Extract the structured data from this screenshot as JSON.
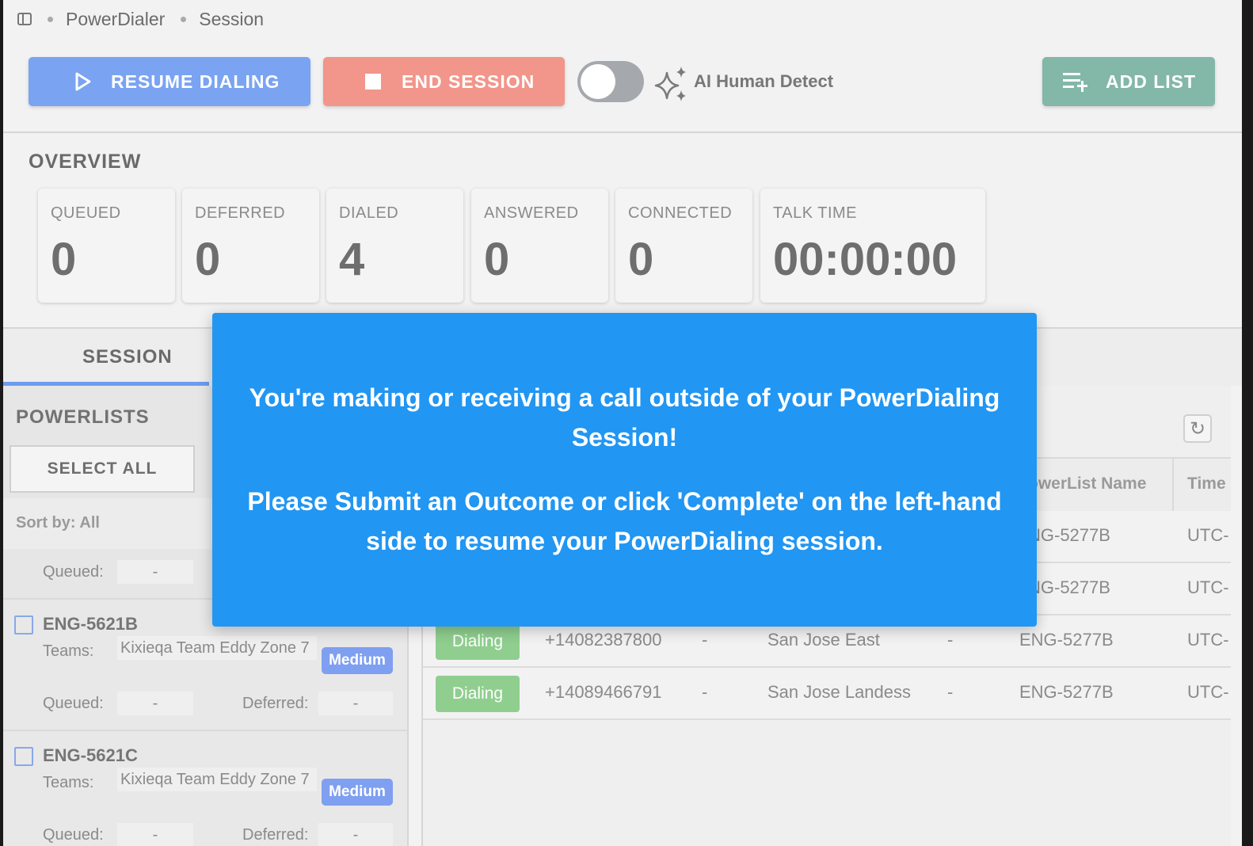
{
  "breadcrumb": [
    "PowerDialer",
    "Session"
  ],
  "toolbar": {
    "resume_label": "RESUME DIALING",
    "end_label": "END SESSION",
    "ai_label": "AI Human Detect",
    "ai_enabled": false,
    "add_list_label": "ADD LIST"
  },
  "overview": {
    "title": "OVERVIEW",
    "stats": [
      {
        "label": "QUEUED",
        "value": "0"
      },
      {
        "label": "DEFERRED",
        "value": "0"
      },
      {
        "label": "DIALED",
        "value": "4"
      },
      {
        "label": "ANSWERED",
        "value": "0"
      },
      {
        "label": "CONNECTED",
        "value": "0"
      },
      {
        "label": "TALK TIME",
        "value": "00:00:00"
      }
    ]
  },
  "tabs": {
    "session": "SESSION"
  },
  "powerlists": {
    "title": "POWERLISTS",
    "select_all": "SELECT ALL",
    "sort_label": "Sort by: All",
    "partial_item": {
      "queued_label": "Queued:",
      "queued_value": "-"
    },
    "items": [
      {
        "name": "ENG-5621B",
        "teams_label": "Teams:",
        "teams": "Kixieqa Team Eddy Zone 7",
        "priority": "Medium",
        "queued_label": "Queued:",
        "queued_value": "-",
        "deferred_label": "Deferred:",
        "deferred_value": "-"
      },
      {
        "name": "ENG-5621C",
        "teams_label": "Teams:",
        "teams": "Kixieqa Team Eddy Zone 7",
        "priority": "Medium",
        "queued_label": "Queued:",
        "queued_value": "-",
        "deferred_label": "Deferred:",
        "deferred_value": "-"
      }
    ]
  },
  "table": {
    "headers": {
      "powerlist_name": "owerList Name",
      "time": "Time"
    },
    "partial_rows": [
      {
        "powerlist": "NG-5277B",
        "time": "UTC-"
      },
      {
        "powerlist": "NG-5277B",
        "time": "UTC-"
      }
    ],
    "rows": [
      {
        "status": "Dialing",
        "phone": "+14082387800",
        "col3": "-",
        "location": "San Jose East",
        "col5": "-",
        "powerlist": "ENG-5277B",
        "time": "UTC-"
      },
      {
        "status": "Dialing",
        "phone": "+14089466791",
        "col3": "-",
        "location": "San Jose Landess",
        "col5": "-",
        "powerlist": "ENG-5277B",
        "time": "UTC-"
      }
    ]
  },
  "modal": {
    "line1": "You're making or receiving a call outside of your PowerDialing Session!",
    "line2": "Please Submit an Outcome or click 'Complete' on the left-hand side to resume your PowerDialing session."
  },
  "colors": {
    "modal_bg": "#2196f3",
    "resume": "#7aa3f2",
    "end": "#f2958a",
    "add": "#83b7a8",
    "dialing": "#8fce8f",
    "medium": "#7f9ff0"
  },
  "icons": [
    "sidebar-toggle-icon",
    "play-icon",
    "stop-icon",
    "sparkle-icon",
    "playlist-add-icon",
    "refresh-icon",
    "checkbox-icon"
  ]
}
